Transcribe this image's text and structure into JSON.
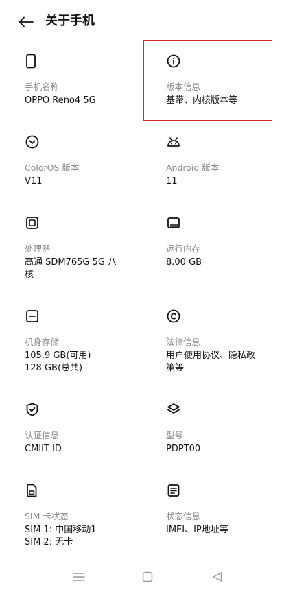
{
  "header": {
    "title": "关于手机"
  },
  "items": [
    {
      "icon": "phone-icon",
      "label": "手机名称",
      "value_lines": [
        "OPPO Reno4 5G"
      ]
    },
    {
      "icon": "info-icon",
      "label": "版本信息",
      "value_lines": [
        "基带、内核版本等"
      ]
    },
    {
      "icon": "coloros-icon",
      "label": "ColorOS 版本",
      "value_lines": [
        "V11"
      ]
    },
    {
      "icon": "android-icon",
      "label": "Android 版本",
      "value_lines": [
        "11"
      ]
    },
    {
      "icon": "processor-icon",
      "label": "处理器",
      "value_lines": [
        "高通 SDM765G 5G 八",
        "核"
      ]
    },
    {
      "icon": "memory-icon",
      "label": "运行内存",
      "value_lines": [
        "8.00 GB"
      ]
    },
    {
      "icon": "storage-icon",
      "label": "机身存储",
      "value_lines": [
        "105.9 GB(可用)",
        "128 GB(总共)"
      ]
    },
    {
      "icon": "copyright-icon",
      "label": "法律信息",
      "value_lines": [
        "用户使用协议、隐私政",
        "策等"
      ]
    },
    {
      "icon": "shield-check-icon",
      "label": "认证信息",
      "value_lines": [
        "CMIIT ID"
      ]
    },
    {
      "icon": "layers-icon",
      "label": "型号",
      "value_lines": [
        "PDPT00"
      ]
    },
    {
      "icon": "sim-card-icon",
      "label": "SIM 卡状态",
      "value_lines": [
        "SIM 1: 中国移动1",
        "SIM 2: 无卡"
      ]
    },
    {
      "icon": "document-icon",
      "label": "状态信息",
      "value_lines": [
        "IMEI、IP地址等"
      ]
    }
  ],
  "navbar": {
    "icons": [
      "menu-icon",
      "home-square-icon",
      "back-triangle-icon"
    ]
  },
  "colors": {
    "highlight": "#e4262b",
    "label": "#8a8a8a",
    "text": "#111111"
  }
}
